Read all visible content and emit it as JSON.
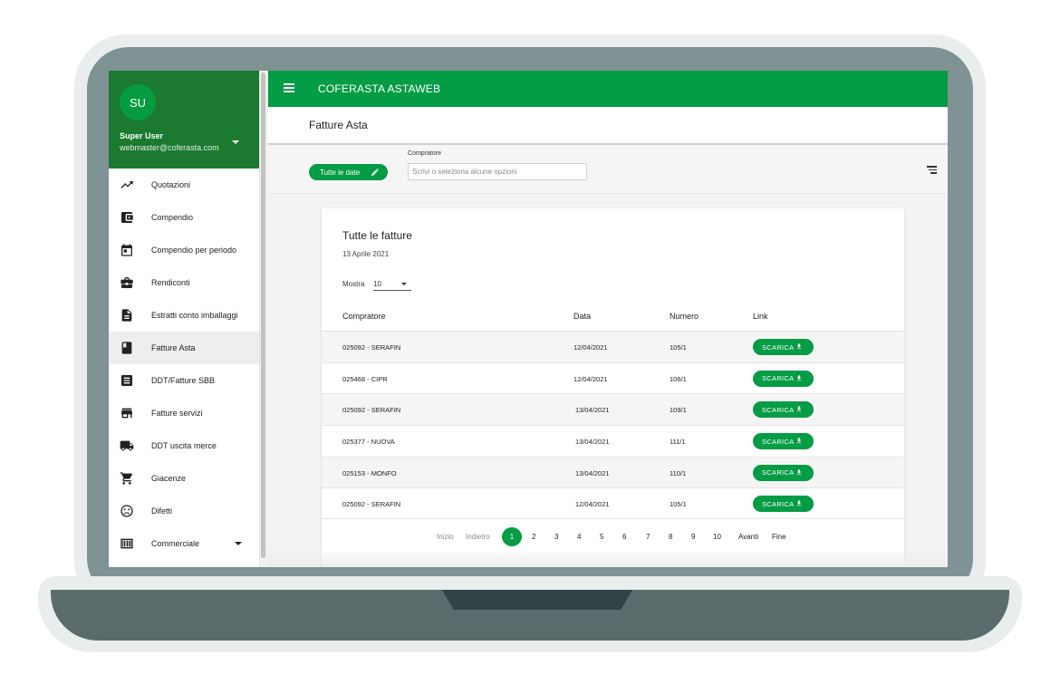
{
  "app": {
    "title": "COFERASTA ASTAWEB"
  },
  "user": {
    "initials": "SU",
    "name": "Super User",
    "email": "webmaster@coferasta.com"
  },
  "sidebar": {
    "items": [
      {
        "label": "Quotazioni",
        "icon": "trending-up-icon"
      },
      {
        "label": "Compendio",
        "icon": "wallet-icon"
      },
      {
        "label": "Compendio per periodo",
        "icon": "calendar-icon"
      },
      {
        "label": "Rendiconti",
        "icon": "briefcase-icon"
      },
      {
        "label": "Estratti conto imballaggi",
        "icon": "document-icon"
      },
      {
        "label": "Fatture Asta",
        "icon": "book-icon",
        "active": true
      },
      {
        "label": "DDT/Fatture SBB",
        "icon": "list-icon"
      },
      {
        "label": "Fatture servizi",
        "icon": "store-icon"
      },
      {
        "label": "DDT uscita merce",
        "icon": "truck-icon"
      },
      {
        "label": "Giacenze",
        "icon": "cart-icon"
      },
      {
        "label": "Difetti",
        "icon": "sad-face-icon"
      },
      {
        "label": "Commerciale",
        "icon": "barcode-icon",
        "expandable": true
      }
    ]
  },
  "page": {
    "title": "Fatture Asta"
  },
  "filters": {
    "date_chip": "Tutte le date",
    "buyer_label": "Compratore",
    "buyer_placeholder": "Scrivi o seleziona alcune opzioni"
  },
  "card": {
    "title": "Tutte le fatture",
    "date": "13 Aprile 2021",
    "show_label": "Mostra",
    "show_value": "10"
  },
  "table": {
    "headers": {
      "buyer": "Compratore",
      "date": "Data",
      "number": "Numero",
      "link": "Link"
    },
    "rows": [
      {
        "buyer": "025092 - SERAFIN",
        "date": "12/04/2021",
        "number": "105/1",
        "link": "SCARICA"
      },
      {
        "buyer": "025468 - CIPR",
        "date": "12/04/2021",
        "number": "106/1",
        "link": "SCARICA"
      },
      {
        "buyer": "025092 - SERAFIN",
        "date": "13/04/2021",
        "number": "109/1",
        "link": "SCARICA"
      },
      {
        "buyer": "025377 - NUOVA",
        "date": "13/04/2021",
        "number": "111/1",
        "link": "SCARICA"
      },
      {
        "buyer": "025153 - MONFO",
        "date": "13/04/2021",
        "number": "110/1",
        "link": "SCARICA"
      },
      {
        "buyer": "025092 - SERAFIN",
        "date": "12/04/2021",
        "number": "105/1",
        "link": "SCARICA"
      }
    ]
  },
  "pagination": {
    "first": "Inizio",
    "prev": "Indietro",
    "current": "1",
    "pages": [
      "2",
      "3",
      "4",
      "5",
      "6",
      "7",
      "8",
      "9",
      "10"
    ],
    "next": "Avanti",
    "last": "Fine"
  },
  "colors": {
    "primary": "#049c44",
    "header_dark": "#1b7a2f"
  }
}
